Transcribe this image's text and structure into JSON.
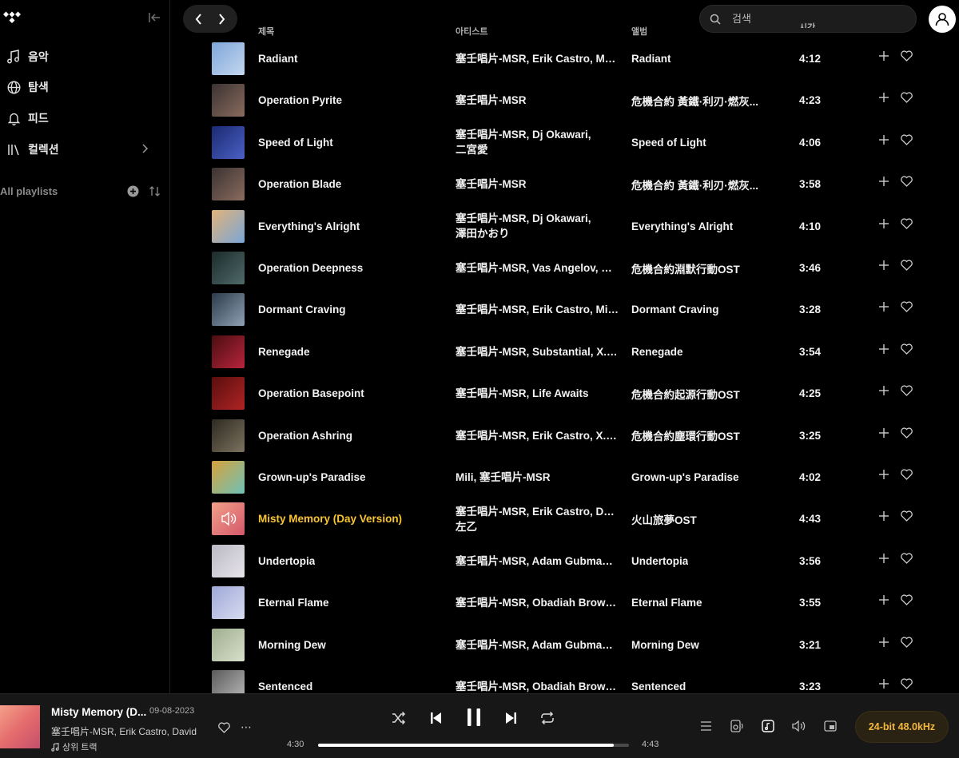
{
  "sidebar": {
    "nav": [
      {
        "label": "음악",
        "icon": "music-note-icon"
      },
      {
        "label": "탐색",
        "icon": "globe-icon"
      },
      {
        "label": "피드",
        "icon": "bell-icon"
      },
      {
        "label": "컬렉션",
        "icon": "collection-icon"
      }
    ],
    "playlists_label": "All playlists"
  },
  "search": {
    "placeholder": "검색"
  },
  "columns": {
    "title": "제목",
    "artist": "아티스트",
    "album": "앨범",
    "duration": "시간"
  },
  "tracks": [
    {
      "title": "Radiant",
      "artist": "塞壬唱片-MSR, Erik Castro, Mar...",
      "album": "Radiant",
      "duration": "4:12",
      "art": [
        "#7fa6d8",
        "#c4d7f0"
      ]
    },
    {
      "title": "Operation Pyrite",
      "artist": "塞壬唱片-MSR",
      "album": "危機合約 黃鐵·利刃·燃灰...",
      "duration": "4:23",
      "art": [
        "#3b3232",
        "#8a6c5e"
      ]
    },
    {
      "title": "Speed of Light",
      "artist": "塞壬唱片-MSR, Dj Okawari,\n二宮愛",
      "album": "Speed of Light",
      "duration": "4:06",
      "art": [
        "#1c2a72",
        "#4a60c4"
      ]
    },
    {
      "title": "Operation Blade",
      "artist": "塞壬唱片-MSR",
      "album": "危機合約 黃鐵·利刃·燃灰...",
      "duration": "3:58",
      "art": [
        "#3b3232",
        "#8a6c5e"
      ]
    },
    {
      "title": "Everything's Alright",
      "artist": "塞壬唱片-MSR, Dj Okawari,\n澤田かおり",
      "album": "Everything's Alright",
      "duration": "4:10",
      "art": [
        "#e2b37a",
        "#7aa6d6"
      ]
    },
    {
      "title": "Operation Deepness",
      "artist": "塞壬唱片-MSR, Vas Angelov, Bai...",
      "album": "危機合約淵默行動OST",
      "duration": "3:46",
      "art": [
        "#1c2a2a",
        "#4f6b6a"
      ]
    },
    {
      "title": "Dormant Craving",
      "artist": "塞壬唱片-MSR, Erik Castro, Min...",
      "album": "Dormant Craving",
      "duration": "3:28",
      "art": [
        "#2c3a4a",
        "#8ea1b4"
      ]
    },
    {
      "title": "Renegade",
      "artist": "塞壬唱片-MSR, Substantial, X. A...",
      "album": "Renegade",
      "duration": "3:54",
      "art": [
        "#4a0e12",
        "#b8243a"
      ]
    },
    {
      "title": "Operation Basepoint",
      "artist": "塞壬唱片-MSR, Life Awaits",
      "album": "危機合約起源行動OST",
      "duration": "4:25",
      "art": [
        "#5a0e0e",
        "#b02424"
      ]
    },
    {
      "title": "Operation Ashring",
      "artist": "塞壬唱片-MSR, Erik Castro, X. ARI",
      "album": "危機合約塵環行動OST",
      "duration": "3:25",
      "art": [
        "#2e2a22",
        "#7c725e"
      ]
    },
    {
      "title": "Grown-up's Paradise",
      "artist": "Mili, 塞壬唱片-MSR",
      "album": "Grown-up's Paradise",
      "duration": "4:02",
      "art": [
        "#d6a13a",
        "#6ec2b8"
      ]
    },
    {
      "title": "Misty Memory (Day Version)",
      "artist": "塞壬唱片-MSR, Erik Castro, Davi...\n左乙",
      "album": "火山旅夢OST",
      "duration": "4:43",
      "art": [
        "#f2a08a",
        "#d4586a"
      ]
    },
    {
      "title": "Undertopia",
      "artist": "塞壬唱片-MSR, Adam Gubman,...",
      "album": "Undertopia",
      "duration": "3:56",
      "art": [
        "#b9b9c4",
        "#e8e4ea"
      ]
    },
    {
      "title": "Eternal Flame",
      "artist": "塞壬唱片-MSR, Obadiah Brown-...",
      "album": "Eternal Flame",
      "duration": "3:55",
      "art": [
        "#9ea8d8",
        "#d8dcf0"
      ]
    },
    {
      "title": "Morning Dew",
      "artist": "塞壬唱片-MSR, Adam Gubman,...",
      "album": "Morning Dew",
      "duration": "3:21",
      "art": [
        "#9fae8e",
        "#d8e0cc"
      ]
    },
    {
      "title": "Sentenced",
      "artist": "塞壬唱片-MSR, Obadiah Brown-...",
      "album": "Sentenced",
      "duration": "3:23",
      "art": [
        "#5a5a5a",
        "#bdbdbd"
      ]
    }
  ],
  "active_index": 11,
  "player": {
    "title": "Misty Memory (D...",
    "date": "09-08-2023",
    "artist": "塞壬唱片-MSR, Erik Castro, David L",
    "source": "상위 트랙",
    "elapsed": "4:30",
    "total": "4:43",
    "progress_percent": 95,
    "quality": "24-bit 48.0kHz",
    "accent_color": "#f8c531"
  }
}
